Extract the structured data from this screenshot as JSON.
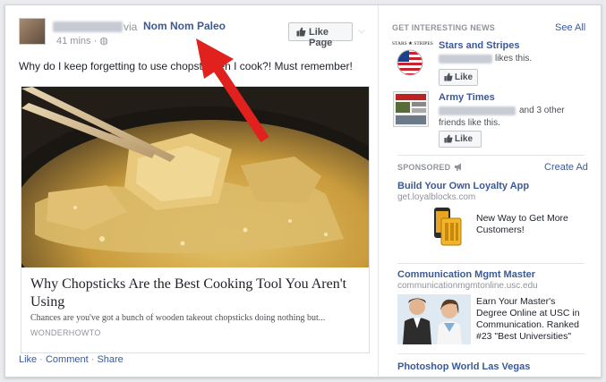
{
  "post": {
    "via": "via",
    "page_name": "Nom Nom Paleo",
    "time": "41 mins · ◍",
    "like_page_label": "Like Page",
    "text": "Why do I keep forgetting to use chopst       when I cook?! Must remember!",
    "card": {
      "title": "Why Chopsticks Are the Best Cooking Tool You Aren't Using",
      "description": "Chances are you've got a bunch of wooden takeout chopsticks doing nothing but...",
      "domain": "WONDERHOWTO"
    },
    "actions": {
      "like": "Like",
      "comment": "Comment",
      "share": "Share",
      "separator": " · "
    }
  },
  "sidebar": {
    "news_header": "GET INTERESTING NEWS",
    "see_all": "See All",
    "pages": [
      {
        "name": "Stars and Stripes",
        "logo_text": "STARS ★ STRIPES",
        "line1": "likes this.",
        "like_label": "Like"
      },
      {
        "name": "Army Times",
        "line1": "and 3 other",
        "line2": "friends like this.",
        "like_label": "Like"
      }
    ],
    "sponsored_header": "SPONSORED",
    "create_ad": "Create Ad",
    "ads": [
      {
        "title": "Build Your Own Loyalty App",
        "domain": "get.loyalblocks.com",
        "body": "New Way to Get More Customers!"
      },
      {
        "title": "Communication Mgmt Master",
        "domain": "communicationmgmtonline.usc.edu",
        "body": "Earn Your Master's Degree Online at USC in Communication. Ranked #23 \"Best Universities\""
      },
      {
        "title": "Photoshop World Las Vegas"
      }
    ]
  },
  "colors": {
    "link": "#3b5998",
    "arrow": "#e0211d",
    "muted": "#90949c"
  }
}
